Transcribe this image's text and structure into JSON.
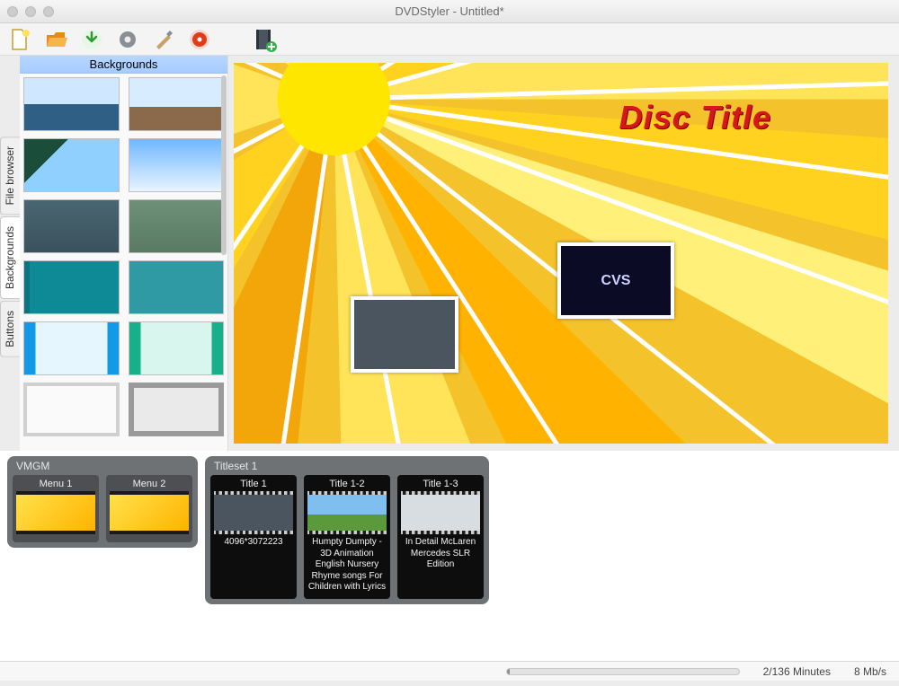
{
  "window": {
    "title": "DVDStyler - Untitled*"
  },
  "toolbar": {
    "new": "new-project",
    "open": "open-project",
    "save": "save-project",
    "settings": "settings",
    "tools": "tools",
    "burn": "burn-disc",
    "addvideo": "add-video"
  },
  "side_tabs": {
    "file_browser": "File browser",
    "backgrounds": "Backgrounds",
    "buttons": "Buttons"
  },
  "side_panel": {
    "header": "Backgrounds"
  },
  "backgrounds": [
    {
      "name": "seascape-1"
    },
    {
      "name": "seascape-shipwreck"
    },
    {
      "name": "coastline"
    },
    {
      "name": "sky-gradient"
    },
    {
      "name": "slate"
    },
    {
      "name": "sage"
    },
    {
      "name": "teal-vertical"
    },
    {
      "name": "teal-texture"
    },
    {
      "name": "blue-border"
    },
    {
      "name": "green-border"
    },
    {
      "name": "light-frame"
    },
    {
      "name": "grey-frame"
    }
  ],
  "menu_preview": {
    "title_text": "Disc Title",
    "accent_color": "#d81818",
    "thumb_b_label": "CVS"
  },
  "timeline": {
    "groups": [
      {
        "name": "VMGM",
        "items": [
          {
            "header": "Menu 1",
            "caption": "",
            "type": "menu"
          },
          {
            "header": "Menu 2",
            "caption": "",
            "type": "menu"
          }
        ]
      },
      {
        "name": "Titleset 1",
        "items": [
          {
            "header": "Title 1",
            "caption": "4096*3072223",
            "type": "title"
          },
          {
            "header": "Title 1-2",
            "caption": "Humpty Dumpty - 3D Animation English Nursery Rhyme songs For Children with Lyrics",
            "type": "title"
          },
          {
            "header": "Title 1-3",
            "caption": "In Detail McLaren Mercedes SLR Edition",
            "type": "title"
          }
        ]
      }
    ]
  },
  "status": {
    "minutes": "2/136 Minutes",
    "bitrate": "8 Mb/s",
    "progress_percent": 1.5
  }
}
